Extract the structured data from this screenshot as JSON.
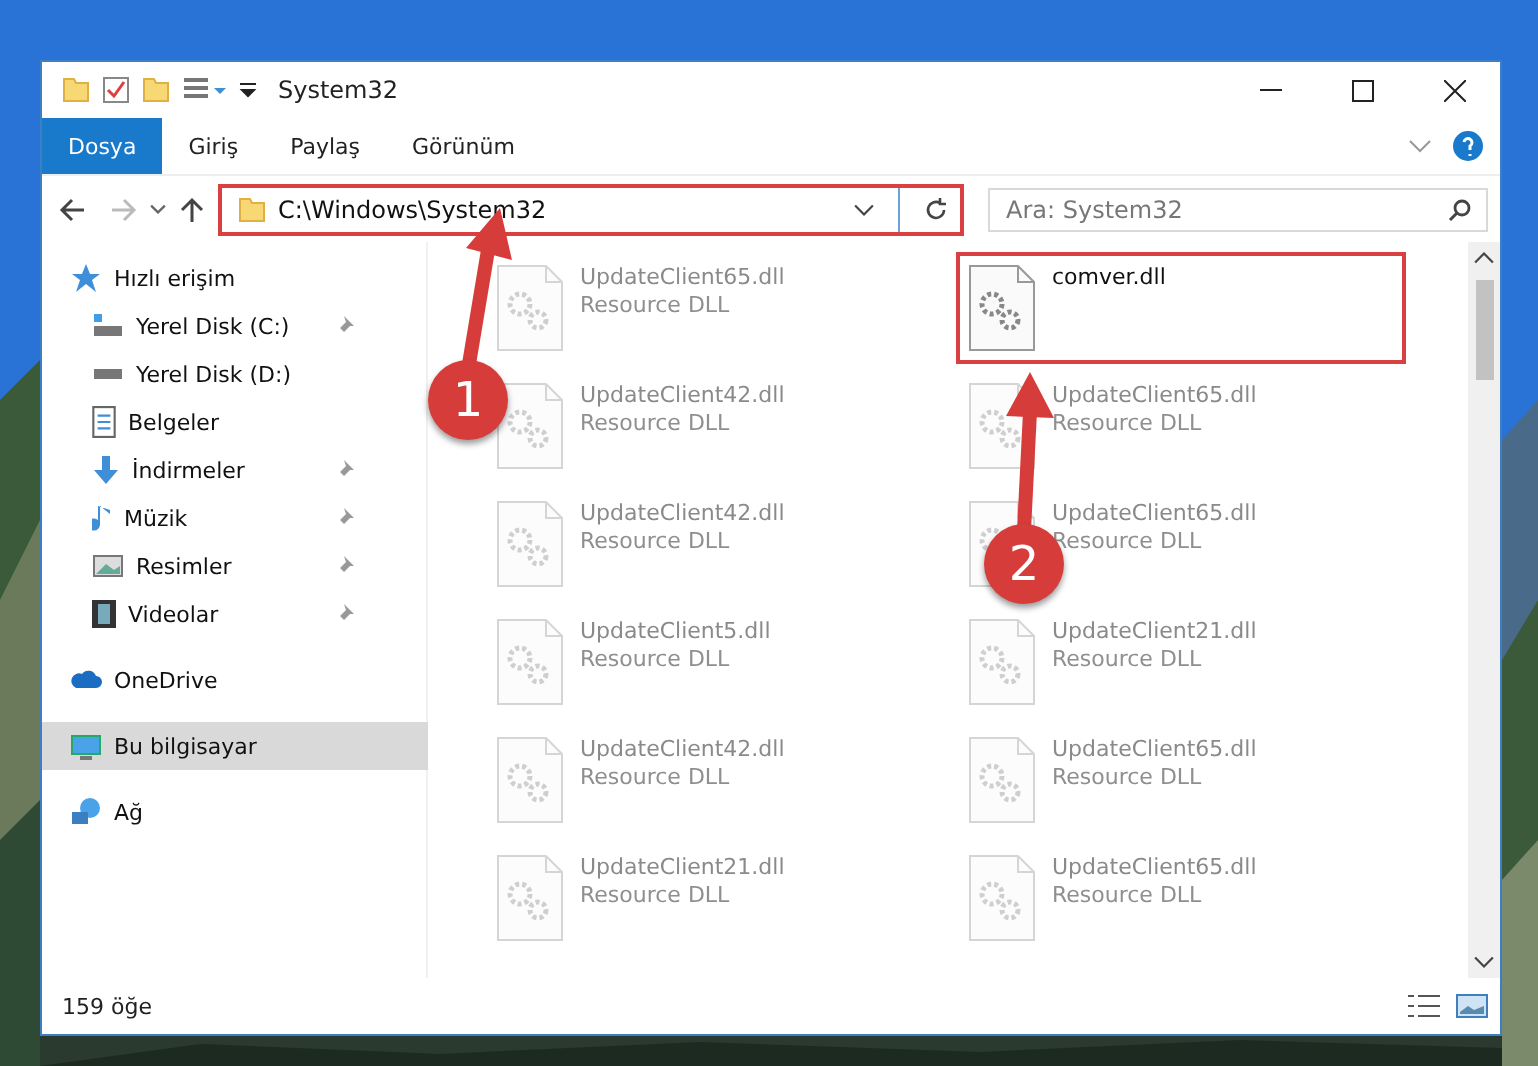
{
  "window": {
    "title": "System32"
  },
  "ribbon_tabs": [
    {
      "label": "Dosya",
      "selected": true
    },
    {
      "label": "Giriş",
      "selected": false
    },
    {
      "label": "Paylaş",
      "selected": false
    },
    {
      "label": "Görünüm",
      "selected": false
    }
  ],
  "address": {
    "path": "C:\\Windows\\System32",
    "highlighted": true
  },
  "search": {
    "placeholder": "Ara: System32"
  },
  "sidebar": {
    "items": [
      {
        "label": "Hızlı erişim",
        "selected": false,
        "children": [
          {
            "label": "Yerel Disk (C:)",
            "pinned": true,
            "selected": false
          },
          {
            "label": "Yerel Disk (D:)",
            "pinned": false,
            "selected": false
          },
          {
            "label": "Belgeler",
            "pinned": false,
            "selected": false
          },
          {
            "label": "İndirmeler",
            "pinned": true,
            "selected": false
          },
          {
            "label": "Müzik",
            "pinned": true,
            "selected": false
          },
          {
            "label": "Resimler",
            "pinned": true,
            "selected": false
          },
          {
            "label": "Videolar",
            "pinned": true,
            "selected": false
          }
        ]
      },
      {
        "label": "OneDrive",
        "selected": false
      },
      {
        "label": "Bu bilgisayar",
        "selected": true
      },
      {
        "label": "Ağ",
        "selected": false
      }
    ]
  },
  "files": [
    {
      "name": "UpdateClient65.dll",
      "type": "Resource DLL",
      "blurred": true,
      "highlighted": false
    },
    {
      "name": "comver.dll",
      "blurred": false,
      "highlighted": true
    },
    {
      "name": "UpdateClient42.dll",
      "type": "Resource DLL",
      "blurred": true,
      "highlighted": false
    },
    {
      "name": "UpdateClient65.dll",
      "type": "Resource DLL",
      "blurred": true,
      "highlighted": false
    },
    {
      "name": "UpdateClient42.dll",
      "type": "Resource DLL",
      "blurred": true,
      "highlighted": false
    },
    {
      "name": "UpdateClient65.dll",
      "type": "Resource DLL",
      "blurred": true,
      "highlighted": false
    },
    {
      "name": "UpdateClient5.dll",
      "type": "Resource DLL",
      "blurred": true,
      "highlighted": false
    },
    {
      "name": "UpdateClient21.dll",
      "type": "Resource DLL",
      "blurred": true,
      "highlighted": false
    },
    {
      "name": "UpdateClient42.dll",
      "type": "Resource DLL",
      "blurred": true,
      "highlighted": false
    },
    {
      "name": "UpdateClient65.dll",
      "type": "Resource DLL",
      "blurred": true,
      "highlighted": false
    },
    {
      "name": "UpdateClient21.dll",
      "type": "Resource DLL",
      "blurred": true,
      "highlighted": false
    },
    {
      "name": "UpdateClient65.dll",
      "type": "Resource DLL",
      "blurred": true,
      "highlighted": false
    }
  ],
  "status_bar": {
    "count": "159 öğe"
  },
  "annotations": [
    {
      "label": "1"
    },
    {
      "label": "2"
    }
  ]
}
